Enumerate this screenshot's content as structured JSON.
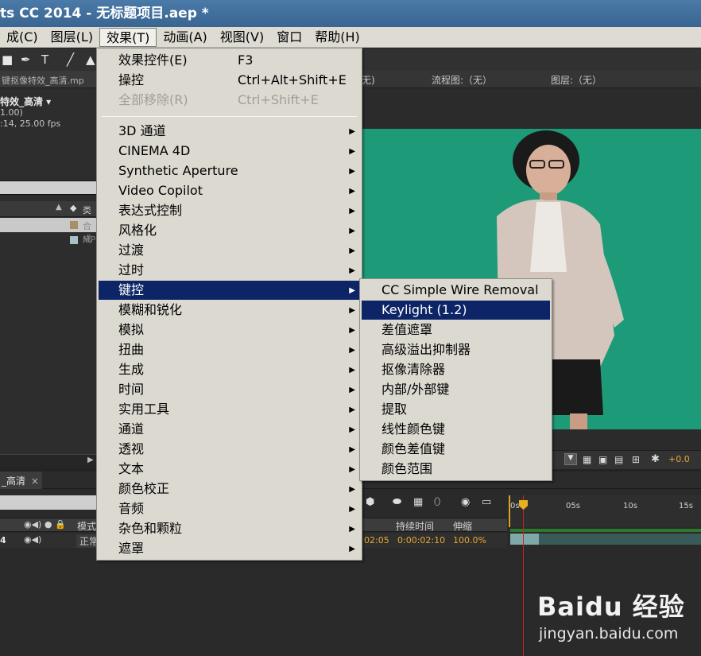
{
  "window": {
    "title": "ts CC 2014 - 无标题项目.aep *"
  },
  "menubar": [
    {
      "label": "成(C)"
    },
    {
      "label": "图层(L)"
    },
    {
      "label": "效果(T)",
      "active": true
    },
    {
      "label": "动画(A)"
    },
    {
      "label": "视图(V)"
    },
    {
      "label": "窗口"
    },
    {
      "label": "帮助(H)"
    }
  ],
  "effects_menu": {
    "top_items": [
      {
        "label": "效果控件(E)",
        "shortcut": "F3",
        "enabled": true
      },
      {
        "label": "操控",
        "shortcut": "Ctrl+Alt+Shift+E",
        "enabled": true
      },
      {
        "label": "全部移除(R)",
        "shortcut": "Ctrl+Shift+E",
        "enabled": false
      }
    ],
    "categories": [
      "3D 通道",
      "CINEMA 4D",
      "Synthetic Aperture",
      "Video Copilot",
      "表达式控制",
      "风格化",
      "过渡",
      "过时",
      "键控",
      "模糊和锐化",
      "模拟",
      "扭曲",
      "生成",
      "时间",
      "实用工具",
      "通道",
      "透视",
      "文本",
      "颜色校正",
      "音频",
      "杂色和颗粒",
      "遮罩"
    ],
    "highlighted": "键控"
  },
  "keying_menu": {
    "items": [
      "CC Simple Wire Removal",
      "Keylight (1.2)",
      "差值遮罩",
      "高级溢出抑制器",
      "抠像清除器",
      "内部/外部键",
      "提取",
      "线性颜色键",
      "颜色差值键",
      "颜色范围"
    ],
    "highlighted": "Keylight (1.2)"
  },
  "project_panel": {
    "tab_label": "键抠像特效_高清.mp",
    "comp_name": "特效_高清 ▾",
    "comp_line2": "1.00)",
    "comp_line3": ":14, 25.00 fps",
    "col_type": "类型",
    "rows": [
      {
        "label": "合成",
        "color": "#a89066"
      },
      {
        "label": "MP",
        "color": "#a6c2c8"
      }
    ]
  },
  "viewer_tabs": {
    "tab1": "无)",
    "tab2": "流程图:（无）",
    "tab3": "图层:（无）"
  },
  "viewer_controls": {
    "exposure": "+0.0"
  },
  "timeline": {
    "tab_label": "_高清",
    "col_mode": "模式",
    "col_duration": "持续时间",
    "col_stretch": "伸缩",
    "row_index": "4",
    "row_mode": "正常",
    "row_out": "02:05",
    "row_duration": "0:00:02:10",
    "row_stretch": "100.0%",
    "ruler": [
      "0s",
      "05s",
      "10s",
      "15s"
    ]
  },
  "watermark": {
    "logo": "Baidu 经验",
    "url": "jingyan.baidu.com"
  },
  "colors": {
    "menu_highlight": "#0d2567",
    "green_screen": "#1d9b78",
    "title_bar": "#3a6592"
  }
}
